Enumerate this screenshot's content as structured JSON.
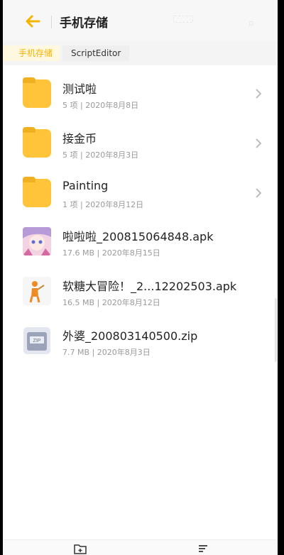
{
  "header": {
    "title": "手机存储",
    "back_icon": "arrow-left-icon",
    "accent": "#f5b400"
  },
  "breadcrumb": {
    "items": [
      "手机存储",
      "ScriptEditor"
    ]
  },
  "files": [
    {
      "name": "测试啦",
      "meta": "5 项 | 2020年8月8日",
      "type": "folder"
    },
    {
      "name": "接金币",
      "meta": "5 项 | 2020年8月3日",
      "type": "folder"
    },
    {
      "name": "Painting",
      "meta": "1 项 | 2020年8月12日",
      "type": "folder"
    },
    {
      "name": "啦啦啦_200815064848.apk",
      "meta": "17.6 MB | 2020年8月15日",
      "type": "apk"
    },
    {
      "name": "软糖大冒险！_2...12202503.apk",
      "meta": "16.5 MB | 2020年8月12日",
      "type": "apk"
    },
    {
      "name": "外婆_200803140500.zip",
      "meta": "7.7 MB | 2020年8月3日",
      "type": "zip"
    }
  ],
  "bottom_bar": {
    "left_icon": "new-folder-icon",
    "right_icon": "sort-icon"
  }
}
